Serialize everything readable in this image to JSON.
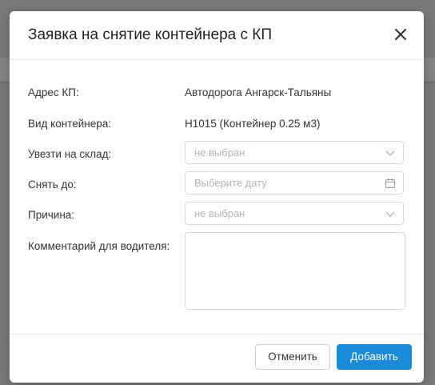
{
  "dialog": {
    "title": "Заявка на снятие контейнера с КП",
    "close_icon": "close-icon"
  },
  "form": {
    "address": {
      "label": "Адрес КП:",
      "value": "Автодорога Ангарск-Тальяны"
    },
    "container_type": {
      "label": "Вид контейнера:",
      "value": "Н1015 (Контейнер 0.25 м3)"
    },
    "warehouse": {
      "label": "Увезти на склад:",
      "placeholder": "не выбран",
      "icon": "chevron-down-icon"
    },
    "remove_by": {
      "label": "Снять до:",
      "placeholder": "Выберите дату",
      "icon": "calendar-icon"
    },
    "reason": {
      "label": "Причина:",
      "placeholder": "не выбран",
      "icon": "chevron-down-icon"
    },
    "comment": {
      "label": "Комментарий для водителя:",
      "value": ""
    }
  },
  "footer": {
    "cancel_label": "Отменить",
    "add_label": "Добавить"
  },
  "colors": {
    "primary": "#1a8ad6",
    "overlay": "#7a7a7a"
  }
}
